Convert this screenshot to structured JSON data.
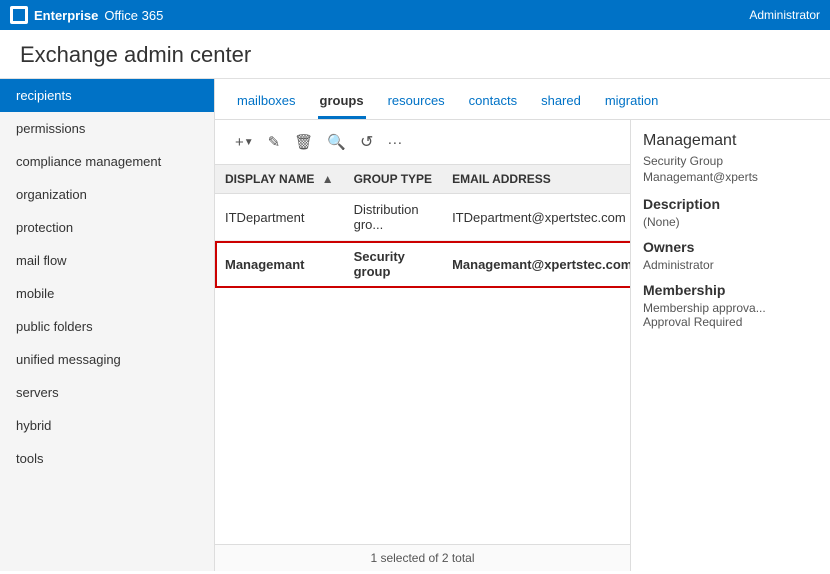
{
  "topbar": {
    "product1": "Enterprise",
    "product2": "Office 365",
    "admin": "Administrator"
  },
  "app": {
    "title": "Exchange admin center"
  },
  "sidebar": {
    "items": [
      {
        "id": "recipients",
        "label": "recipients",
        "active": true
      },
      {
        "id": "permissions",
        "label": "permissions",
        "active": false
      },
      {
        "id": "compliance-management",
        "label": "compliance management",
        "active": false
      },
      {
        "id": "organization",
        "label": "organization",
        "active": false
      },
      {
        "id": "protection",
        "label": "protection",
        "active": false
      },
      {
        "id": "mail-flow",
        "label": "mail flow",
        "active": false
      },
      {
        "id": "mobile",
        "label": "mobile",
        "active": false
      },
      {
        "id": "public-folders",
        "label": "public folders",
        "active": false
      },
      {
        "id": "unified-messaging",
        "label": "unified messaging",
        "active": false
      },
      {
        "id": "servers",
        "label": "servers",
        "active": false
      },
      {
        "id": "hybrid",
        "label": "hybrid",
        "active": false
      },
      {
        "id": "tools",
        "label": "tools",
        "active": false
      }
    ]
  },
  "tabs": [
    {
      "id": "mailboxes",
      "label": "mailboxes",
      "active": false
    },
    {
      "id": "groups",
      "label": "groups",
      "active": true
    },
    {
      "id": "resources",
      "label": "resources",
      "active": false
    },
    {
      "id": "contacts",
      "label": "contacts",
      "active": false
    },
    {
      "id": "shared",
      "label": "shared",
      "active": false
    },
    {
      "id": "migration",
      "label": "migration",
      "active": false
    }
  ],
  "toolbar": {
    "add_icon": "+",
    "edit_icon": "✎",
    "delete_icon": "🗑",
    "search_icon": "🔍",
    "refresh_icon": "↺",
    "more_icon": "…"
  },
  "table": {
    "columns": [
      {
        "id": "display-name",
        "label": "DISPLAY NAME",
        "sortable": true
      },
      {
        "id": "group-type",
        "label": "GROUP TYPE",
        "sortable": false
      },
      {
        "id": "email-address",
        "label": "EMAIL ADDRESS",
        "sortable": false
      }
    ],
    "rows": [
      {
        "id": "row-1",
        "display_name": "ITDepartment",
        "group_type": "Distribution gro...",
        "email": "ITDepartment@xpertstec.com",
        "selected": false
      },
      {
        "id": "row-2",
        "display_name": "Managemant",
        "group_type": "Security group",
        "email": "Managemant@xpertstec.com",
        "selected": true
      }
    ]
  },
  "detail": {
    "name": "Managemant",
    "type": "Security Group",
    "email": "Managemant@xperts",
    "description_label": "Description",
    "description_value": "(None)",
    "owners_label": "Owners",
    "owners_value": "Administrator",
    "membership_label": "Membership",
    "membership_value": "Membership approva...",
    "membership_sub": "Approval Required"
  },
  "status": {
    "text": "1 selected of 2 total"
  }
}
